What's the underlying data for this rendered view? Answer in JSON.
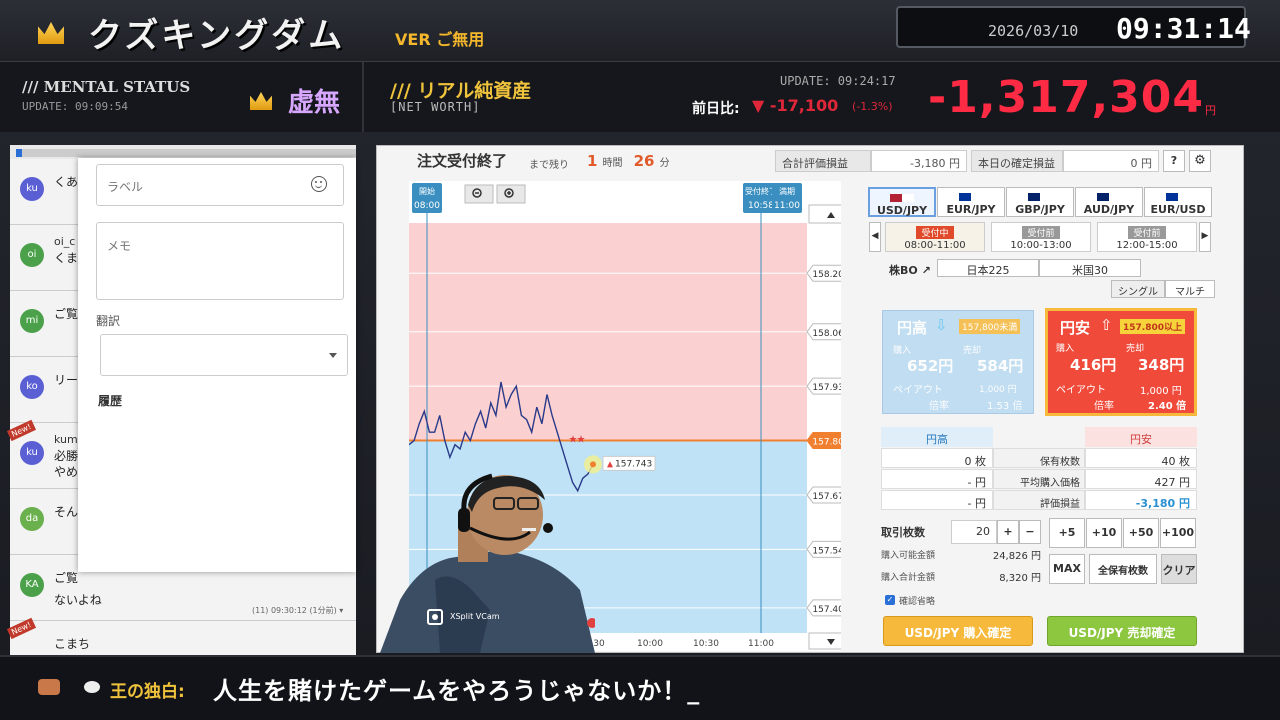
{
  "header": {
    "title": "クズキングダム",
    "version": "VER ご無用",
    "date": "2026/03/10",
    "time": "09:31:14"
  },
  "mental_status": {
    "label": "/// MENTAL STATUS",
    "update": "UPDATE: 09:09:54",
    "value": "虚無"
  },
  "net_worth": {
    "title": "/// リアル純資産",
    "subtitle": "[NET WORTH]",
    "update": "UPDATE: 09:24:17",
    "prev_label": "前日比:",
    "prev_value": "▼ -17,100",
    "prev_pct": "(-1.3%)",
    "value": "-1,317,304",
    "unit": "円"
  },
  "trade": {
    "status": "注文受付終了",
    "remain_label": "まで残り",
    "remain_hours": "1",
    "hours_unit": "時間",
    "remain_minutes": "26",
    "minutes_unit": "分",
    "total_eval_label": "合計評価損益",
    "total_eval_value": "-3,180 円",
    "today_confirmed_label": "本日の確定損益",
    "today_confirmed_value": "0 円",
    "help": "?",
    "pairs": [
      {
        "label": "USD/JPY",
        "selected": true
      },
      {
        "label": "EUR/JPY",
        "selected": false
      },
      {
        "label": "GBP/JPY",
        "selected": false
      },
      {
        "label": "AUD/JPY",
        "selected": false
      },
      {
        "label": "EUR/USD",
        "selected": false
      }
    ],
    "sessions": [
      {
        "badge": "受付中",
        "time": "08:00-11:00",
        "selected": true
      },
      {
        "badge": "受付前",
        "time": "10:00-13:00",
        "selected": false
      },
      {
        "badge": "受付前",
        "time": "12:00-15:00",
        "selected": false
      }
    ],
    "stock_bo": "株BO",
    "nikkei": "日本225",
    "us30": "米国30",
    "single": "シングル",
    "multi": "マルチ",
    "high_card": {
      "title": "円高",
      "cond": "157,800未満",
      "buy_label": "購入",
      "buy_price": "652円",
      "sell_label": "売却",
      "sell_price": "584円",
      "payout_label": "ペイアウト",
      "payout": "1,000 円",
      "rate_label": "倍率",
      "rate": "1.53 倍"
    },
    "low_card": {
      "title": "円安",
      "cond": "157.800以上",
      "buy_label": "購入",
      "buy_price": "416円",
      "sell_label": "売却",
      "sell_price": "348円",
      "payout_label": "ペイアウト",
      "payout": "1,000 円",
      "rate_label": "倍率",
      "rate": "2.40 倍"
    },
    "holdings": {
      "col_high": "円高",
      "col_low": "円安",
      "rows": [
        {
          "high": "0 枚",
          "label": "保有枚数",
          "low": "40 枚"
        },
        {
          "high": "- 円",
          "label": "平均購入価格",
          "low": "427 円"
        },
        {
          "high": "- 円",
          "label": "評価損益",
          "low": "-3,180 円"
        }
      ]
    },
    "qty_label": "取引枚数",
    "qty_value": "20",
    "plus": "+",
    "minus": "−",
    "add_buttons": [
      "+5",
      "+10",
      "+50",
      "+100"
    ],
    "available_label": "購入可能金額",
    "available_value": "24,826 円",
    "total_label": "購入合計金額",
    "total_value": "8,320 円",
    "max": "MAX",
    "all_holdings": "全保有枚数",
    "clear": "クリア",
    "confirm_skip": "確認省略",
    "buy_confirm": "USD/JPY 購入確定",
    "sell_confirm": "USD/JPY 売却確定"
  },
  "chart_data": {
    "type": "line",
    "title": "",
    "y_ticks": [
      "158.200",
      "158.060",
      "157.930",
      "157.800",
      "157.670",
      "157.540",
      "157.400"
    ],
    "ylim": [
      157.34,
      158.32
    ],
    "strike": 157.8,
    "strike_label": "157.800",
    "current_label": "157.743",
    "x_ticks": [
      "30",
      "10:00",
      "10:30",
      "11:00"
    ],
    "markers": [
      {
        "label": "開始",
        "time": "08:00"
      },
      {
        "label": "受付終了",
        "time": "10:58"
      },
      {
        "label": "満期",
        "time": "11:00"
      }
    ],
    "series": [
      {
        "values": [
          157.79,
          157.8,
          157.84,
          157.87,
          157.82,
          157.82,
          157.86,
          157.8,
          157.76,
          157.79,
          157.78,
          157.82,
          157.8,
          157.84,
          157.87,
          157.83,
          157.89,
          157.86,
          157.94,
          157.88,
          157.91,
          157.93,
          157.86,
          157.85,
          157.82,
          157.88,
          157.84,
          157.91,
          157.86,
          157.82,
          157.78,
          157.74,
          157.7,
          157.68,
          157.71,
          157.72,
          157.743
        ]
      }
    ]
  },
  "chat": {
    "messages": [
      {
        "avatar": "ku",
        "text": "くあ"
      },
      {
        "avatar": "oi",
        "name": "oi_c",
        "text": "くま"
      },
      {
        "avatar": "mi",
        "text": "ご覧"
      },
      {
        "avatar": "ko",
        "text": "リー"
      },
      {
        "avatar": "ku",
        "name": "kum",
        "text": "必勝",
        "text2": "やめ"
      },
      {
        "avatar": "da",
        "text": "そん"
      },
      {
        "avatar": "KA",
        "text": "ご覧",
        "text2": "ないよね",
        "meta": "(11) 09:30:12 (1分前) ▾"
      },
      {
        "avatar": "",
        "text": "こまち"
      }
    ],
    "new_badge": "New!",
    "form": {
      "label_placeholder": "ラベル",
      "memo_placeholder": "メモ",
      "translate_label": "翻訳",
      "history_label": "履歴"
    }
  },
  "webcam": {
    "label": "XSplit VCam"
  },
  "ticker": {
    "prefix": "王の独白:",
    "message": "人生を賭けたゲームをやろうじゃないか！_"
  },
  "colors": {
    "loss_red": "#ff2a44",
    "gold": "#f0c33c",
    "chart_upper": "#fbd0d0",
    "chart_lower": "#bfe2f6",
    "strike_line": "#f08030"
  }
}
